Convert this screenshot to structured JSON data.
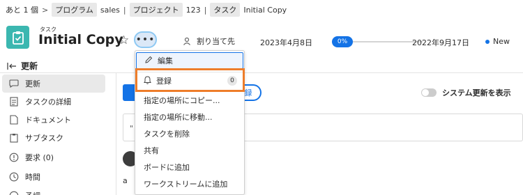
{
  "breadcrumb": {
    "more_label": "あと 1 個",
    "sep": ">",
    "pipe": "|",
    "program_tag": "プログラム",
    "program_name": "sales",
    "project_tag": "プロジェクト",
    "project_name": "123",
    "task_tag": "タスク",
    "task_name": "Initial Copy"
  },
  "header": {
    "kind": "タスク",
    "title": "Initial Copy",
    "assign_label": "割り当て先",
    "start_date": "2023年4月8日",
    "progress_text": "0%",
    "progress_fraction": 0,
    "end_date": "2022年9月17日",
    "status": "New",
    "more_glyph": "•••",
    "star_glyph": "☆"
  },
  "section": {
    "title": "更新"
  },
  "sidebar": {
    "items": [
      {
        "label": "更新",
        "icon": "speech-bubble-icon"
      },
      {
        "label": "タスクの詳細",
        "icon": "document-icon"
      },
      {
        "label": "ドキュメント",
        "icon": "file-icon"
      },
      {
        "label": "サブタスク",
        "icon": "clipboard-icon"
      },
      {
        "label": "要求 (0)",
        "icon": "alert-icon"
      },
      {
        "label": "時間",
        "icon": "clock-icon"
      },
      {
        "label": "予調",
        "icon": "more-icon"
      }
    ]
  },
  "main": {
    "toggle_label": "システム更新を表示",
    "outline_button_label": "録",
    "comment_char": "\"",
    "a_char": "a"
  },
  "menu": {
    "edit": "編集",
    "subscribe": "登録",
    "subscribe_count": "0",
    "copy": "指定の場所にコピー...",
    "move": "指定の場所に移動...",
    "delete": "タスクを削除",
    "share": "共有",
    "add_to_board": "ボードに追加",
    "add_to_workstream": "ワークストリームに追加"
  },
  "colors": {
    "accent": "#1473e6",
    "task_icon_bg": "#3bb7b0",
    "highlight": "#ee7d2a"
  }
}
